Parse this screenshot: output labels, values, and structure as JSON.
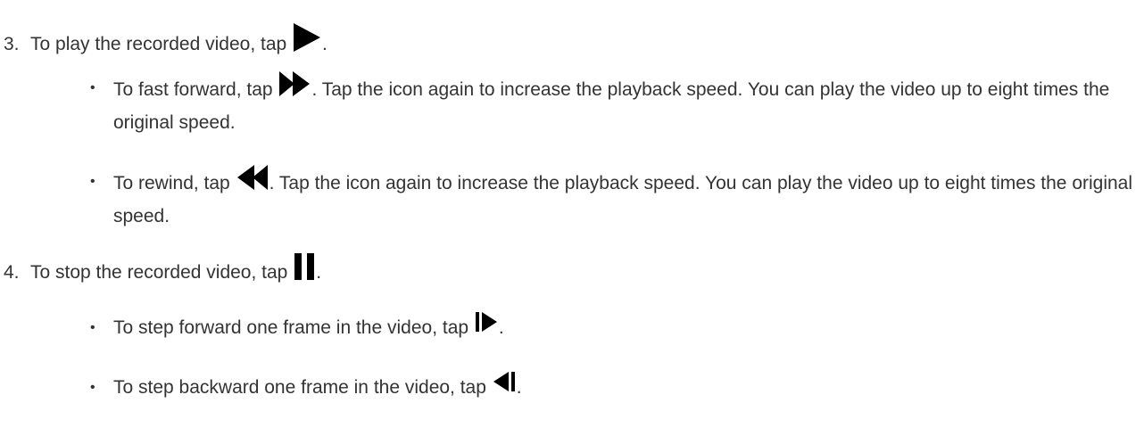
{
  "steps": [
    {
      "number": "3.",
      "text_before": "To play the recorded video, tap",
      "icon": "play-icon",
      "text_after": ".",
      "bullets": [
        {
          "text_before": "To fast forward, tap",
          "icon": "fast-forward-icon",
          "text_after": ". Tap the icon again to increase the playback speed. You can play the video up to eight times the original speed."
        },
        {
          "text_before": "To rewind, tap",
          "icon": "rewind-icon",
          "text_after": ". Tap the icon again to increase the playback speed. You can play the video up to eight times the original speed."
        }
      ]
    },
    {
      "number": "4.",
      "text_before": "To stop the recorded video, tap",
      "icon": "pause-icon",
      "text_after": ".",
      "bullets": [
        {
          "text_before": "To step forward one frame in the video, tap",
          "icon": "step-forward-icon",
          "text_after": "."
        },
        {
          "text_before": "To step backward one frame in the video, tap",
          "icon": "step-backward-icon",
          "text_after": "."
        }
      ]
    }
  ],
  "colors": {
    "text": "#333333",
    "icon": "#000000"
  }
}
